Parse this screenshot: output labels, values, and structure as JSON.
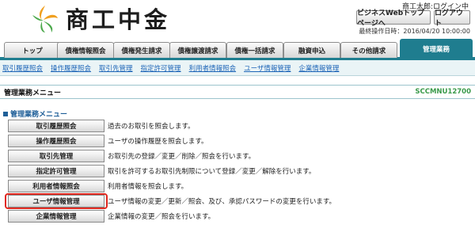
{
  "header": {
    "logo_text": "商工中金",
    "user_info": "商工太郎:ログイン中",
    "homepage_button": "ビジネスWebトップページへ",
    "logout_button": "ログアウト",
    "last_login": "最終操作日時：2016/04/20 10:00:00"
  },
  "tabs": [
    {
      "label": "トップ"
    },
    {
      "label": "債権情報照会"
    },
    {
      "label": "債権発生請求"
    },
    {
      "label": "債権譲渡請求"
    },
    {
      "label": "債権一括請求"
    },
    {
      "label": "融資申込"
    },
    {
      "label": "その他請求"
    },
    {
      "label": "管理業務"
    }
  ],
  "subnav": [
    {
      "label": "取引履歴照会"
    },
    {
      "label": "操作履歴照会"
    },
    {
      "label": "取引先管理"
    },
    {
      "label": "指定許可管理"
    },
    {
      "label": "利用者情報照会"
    },
    {
      "label": "ユーザ情報管理"
    },
    {
      "label": "企業情報管理"
    }
  ],
  "page": {
    "title": "管理業務メニュー",
    "screen_id": "SCCMNU12700",
    "section_title": "管理業務メニュー"
  },
  "menu": [
    {
      "label": "取引履歴照会",
      "desc": "過去のお取引を照会します。"
    },
    {
      "label": "操作履歴照会",
      "desc": "ユーザの操作履歴を照会します。"
    },
    {
      "label": "取引先管理",
      "desc": "お取引先の登録／変更／削除／照会を行います。"
    },
    {
      "label": "指定許可管理",
      "desc": "取引を許可するお取引先制限について登録／変更／解除を行います。"
    },
    {
      "label": "利用者情報照会",
      "desc": "利用者情報を照会します。"
    },
    {
      "label": "ユーザ情報管理",
      "desc": "ユーザ情報の変更／更新／照会、及び、承認パスワードの変更を行います。"
    },
    {
      "label": "企業情報管理",
      "desc": "企業情報の変更／照会を行います。"
    }
  ],
  "colors": {
    "accent": "#1f7d8f",
    "logo_orange": "#f0a020",
    "logo_green": "#4aa84a",
    "link": "#1f66b8",
    "highlight": "#e0281f"
  }
}
